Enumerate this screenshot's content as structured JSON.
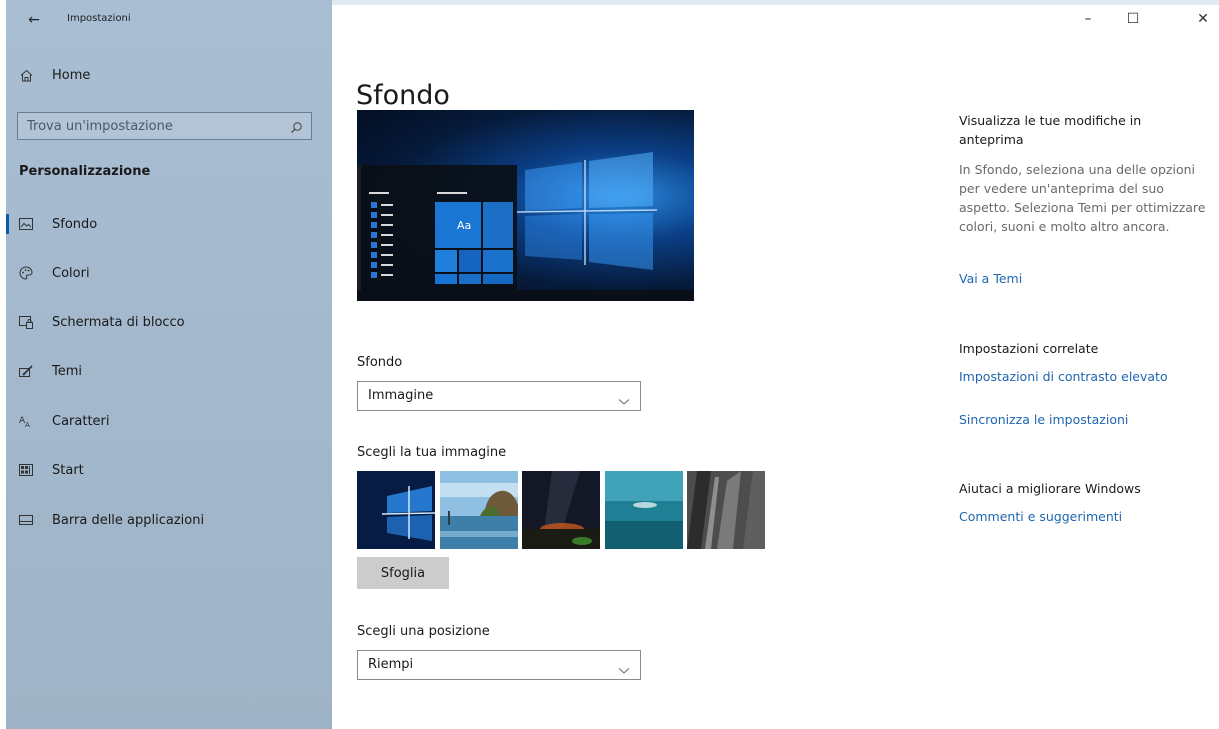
{
  "window": {
    "app_title": "Impostazioni",
    "back_icon": "arrow-left-icon",
    "minimize_label": "–",
    "maximize_label": "☐",
    "close_label": "✕"
  },
  "sidebar": {
    "home_label": "Home",
    "search_placeholder": "Trova un'impostazione",
    "section_heading": "Personalizzazione",
    "items": [
      {
        "label": "Sfondo",
        "icon": "picture-icon",
        "active": true
      },
      {
        "label": "Colori",
        "icon": "palette-icon"
      },
      {
        "label": "Schermata di blocco",
        "icon": "lock-screen-icon"
      },
      {
        "label": "Temi",
        "icon": "brush-icon"
      },
      {
        "label": "Caratteri",
        "icon": "font-icon"
      },
      {
        "label": "Start",
        "icon": "start-icon"
      },
      {
        "label": "Barra delle applicazioni",
        "icon": "taskbar-icon"
      }
    ],
    "accent_color": "#0b5aa8"
  },
  "main": {
    "page_title": "Sfondo",
    "preview_tile_text": "Aa",
    "background_label": "Sfondo",
    "background_value": "Immagine",
    "choose_image_label": "Scegli la tua immagine",
    "browse_label": "Sfoglia",
    "position_label": "Scegli una posizione",
    "position_value": "Riempi"
  },
  "right": {
    "preview_heading": "Visualizza le tue modifiche in anteprima",
    "preview_body": "In Sfondo, seleziona una delle opzioni per vedere un'anteprima del suo aspetto. Seleziona Temi per ottimizzare colori, suoni e molto altro ancora.",
    "themes_link": "Vai a Temi",
    "related_title": "Impostazioni correlate",
    "contrast_link": "Impostazioni di contrasto elevato",
    "sync_link": "Sincronizza le impostazioni",
    "help_title": "Aiutaci a migliorare Windows",
    "feedback_link": "Commenti e suggerimenti",
    "link_color": "#1f66b0"
  }
}
